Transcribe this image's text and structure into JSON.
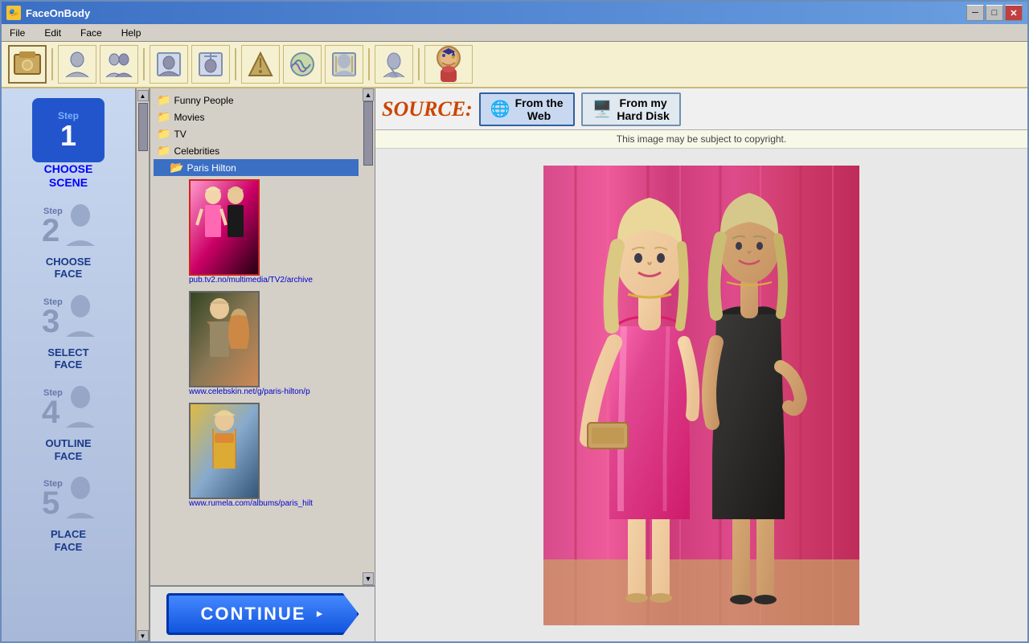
{
  "window": {
    "title": "FaceOnBody",
    "icon": "🎭"
  },
  "title_buttons": {
    "minimize": "─",
    "maximize": "□",
    "close": "✕"
  },
  "menu": {
    "items": [
      "File",
      "Edit",
      "Face",
      "Help"
    ]
  },
  "toolbar": {
    "icons": [
      "📷",
      "👤",
      "👥",
      "🔄",
      "📐",
      "✂️",
      "🎨",
      "💾",
      "📋",
      "❓"
    ]
  },
  "steps": [
    {
      "id": 1,
      "number": "1",
      "label_line1": "CHOOSE",
      "label_line2": "SCENE",
      "active": true
    },
    {
      "id": 2,
      "number": "2",
      "label_line1": "CHOOSE",
      "label_line2": "FACE",
      "active": false
    },
    {
      "id": 3,
      "number": "3",
      "label_line1": "SELECT",
      "label_line2": "FACE",
      "active": false
    },
    {
      "id": 4,
      "number": "4",
      "label_line1": "OUTLINE",
      "label_line2": "FACE",
      "active": false
    },
    {
      "id": 5,
      "number": "5",
      "label_line1": "PLACE",
      "label_line2": "FACE",
      "active": false
    }
  ],
  "tree": {
    "items": [
      {
        "label": "Funny People",
        "level": 0,
        "type": "folder",
        "expanded": true
      },
      {
        "label": "Movies",
        "level": 0,
        "type": "folder",
        "expanded": false
      },
      {
        "label": "TV",
        "level": 0,
        "type": "folder",
        "expanded": false
      },
      {
        "label": "Celebrities",
        "level": 0,
        "type": "folder",
        "expanded": true
      },
      {
        "label": "Paris Hilton",
        "level": 1,
        "type": "folder",
        "expanded": true,
        "selected": true
      }
    ]
  },
  "thumbnails": [
    {
      "url": "pub.tv2.no/multimedia/TV2/archive",
      "selected": true,
      "style": "paris1"
    },
    {
      "url": "www.celebskin.net/g/paris-hilton/p",
      "selected": false,
      "style": "paris2"
    },
    {
      "url": "www.rumela.com/albums/paris_hilt",
      "selected": false,
      "style": "paris3"
    }
  ],
  "continue_button": {
    "label": "CONTINUE"
  },
  "source": {
    "label": "SOURCE:",
    "web_btn": "From the\nWeb",
    "disk_btn": "From my\nHard Disk"
  },
  "copyright_notice": "This image may be subject to copyright.",
  "image": {
    "description": "Paris Hilton with friend - pink and black dresses against pink curtain backdrop"
  }
}
